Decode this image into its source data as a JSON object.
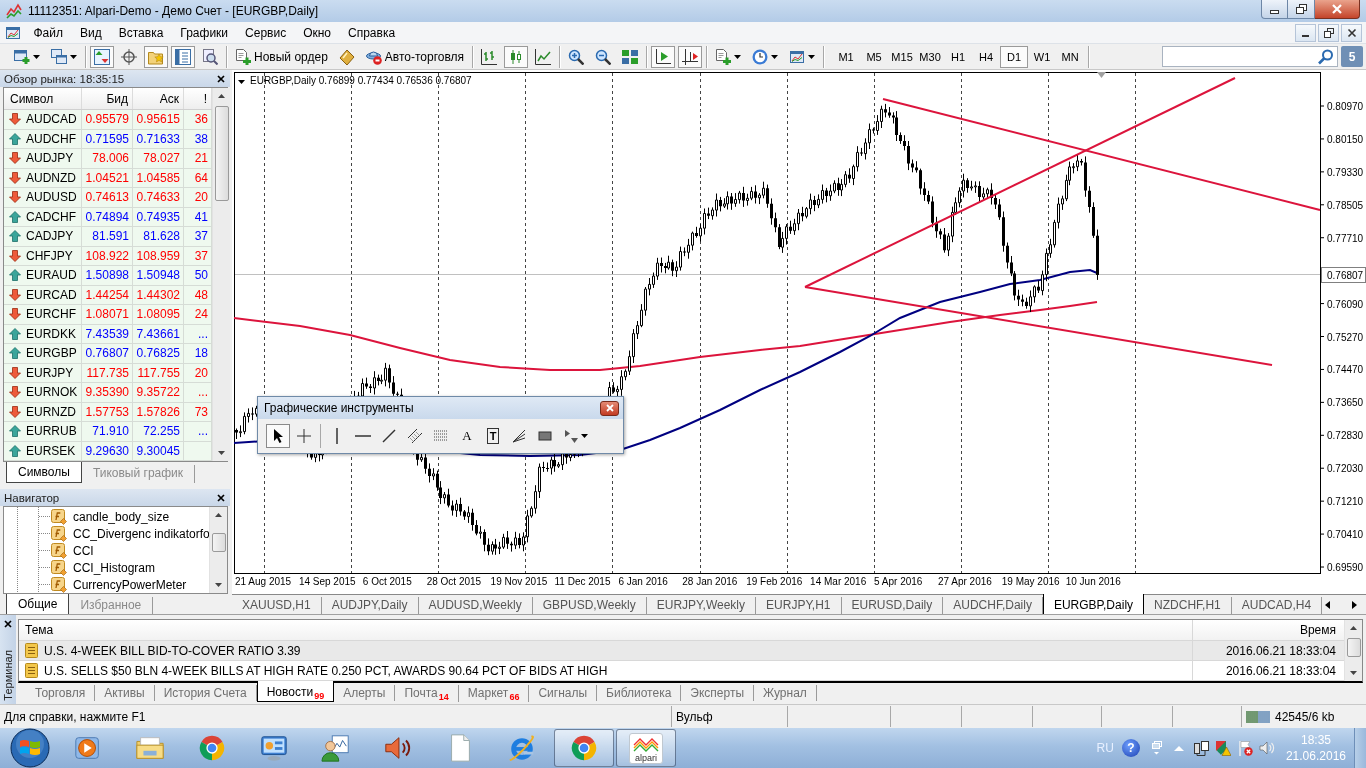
{
  "window": {
    "title": "11112351: Alpari-Demo - Демо Счет - [EURGBP,Daily]"
  },
  "menu": [
    "Файл",
    "Вид",
    "Вставка",
    "Графики",
    "Сервис",
    "Окно",
    "Справка"
  ],
  "toolbar": {
    "groups": [
      [
        {
          "pressed": false,
          "dropdown": true
        },
        {
          "pressed": false,
          "dropdown": true
        }
      ],
      [
        {
          "pressed": true
        },
        {
          "pressed": false
        },
        {
          "pressed": true
        },
        {
          "pressed": true
        },
        {
          "pressed": false
        }
      ],
      [
        {
          "label": "Новый ордер",
          "pressed": false
        },
        {
          "pressed": false
        },
        {
          "label": "Авто-торговля",
          "pressed": false
        }
      ],
      [
        {
          "pressed": false
        },
        {
          "pressed": true
        },
        {
          "pressed": false
        }
      ],
      [
        {
          "pressed": false
        },
        {
          "pressed": false
        },
        {
          "pressed": false
        }
      ],
      [
        {
          "pressed": true
        },
        {
          "pressed": true
        }
      ],
      [
        {
          "pressed": false,
          "dropdown": true
        },
        {
          "pressed": false,
          "dropdown": true
        },
        {
          "pressed": false,
          "dropdown": true
        }
      ]
    ],
    "periods": [
      {
        "label": "M1",
        "selected": false
      },
      {
        "label": "M5",
        "selected": false
      },
      {
        "label": "M15",
        "selected": false
      },
      {
        "label": "M30",
        "selected": false
      },
      {
        "label": "H1",
        "selected": false
      },
      {
        "label": "H4",
        "selected": false
      },
      {
        "label": "D1",
        "selected": true
      },
      {
        "label": "W1",
        "selected": false
      },
      {
        "label": "MN",
        "selected": false
      }
    ],
    "messages": "5"
  },
  "market_watch": {
    "title": "Обзор рынка: 18:35:15",
    "columns": [
      "Символ",
      "Бид",
      "Аск",
      "!"
    ],
    "rows": [
      {
        "symbol": "AUDCAD",
        "bid": "0.95579",
        "ask": "0.95615",
        "spread": "36",
        "rising": false
      },
      {
        "symbol": "AUDCHF",
        "bid": "0.71595",
        "ask": "0.71633",
        "spread": "38",
        "rising": true
      },
      {
        "symbol": "AUDJPY",
        "bid": "78.006",
        "ask": "78.027",
        "spread": "21",
        "rising": false
      },
      {
        "symbol": "AUDNZD",
        "bid": "1.04521",
        "ask": "1.04585",
        "spread": "64",
        "rising": false
      },
      {
        "symbol": "AUDUSD",
        "bid": "0.74613",
        "ask": "0.74633",
        "spread": "20",
        "rising": false
      },
      {
        "symbol": "CADCHF",
        "bid": "0.74894",
        "ask": "0.74935",
        "spread": "41",
        "rising": true
      },
      {
        "symbol": "CADJPY",
        "bid": "81.591",
        "ask": "81.628",
        "spread": "37",
        "rising": true
      },
      {
        "symbol": "CHFJPY",
        "bid": "108.922",
        "ask": "108.959",
        "spread": "37",
        "rising": false
      },
      {
        "symbol": "EURAUD",
        "bid": "1.50898",
        "ask": "1.50948",
        "spread": "50",
        "rising": true
      },
      {
        "symbol": "EURCAD",
        "bid": "1.44254",
        "ask": "1.44302",
        "spread": "48",
        "rising": false
      },
      {
        "symbol": "EURCHF",
        "bid": "1.08071",
        "ask": "1.08095",
        "spread": "24",
        "rising": false
      },
      {
        "symbol": "EURDKK",
        "bid": "7.43539",
        "ask": "7.43661",
        "spread": "...",
        "rising": true
      },
      {
        "symbol": "EURGBP",
        "bid": "0.76807",
        "ask": "0.76825",
        "spread": "18",
        "rising": true
      },
      {
        "symbol": "EURJPY",
        "bid": "117.735",
        "ask": "117.755",
        "spread": "20",
        "rising": false
      },
      {
        "symbol": "EURNOK",
        "bid": "9.35390",
        "ask": "9.35722",
        "spread": "...",
        "rising": false
      },
      {
        "symbol": "EURNZD",
        "bid": "1.57753",
        "ask": "1.57826",
        "spread": "73",
        "rising": false
      },
      {
        "symbol": "EURRUB",
        "bid": "71.910",
        "ask": "72.255",
        "spread": "...",
        "rising": true
      },
      {
        "symbol": "EURSEK",
        "bid": "9.29630",
        "ask": "9.30045",
        "rising": true
      }
    ],
    "tabs": [
      {
        "label": "Символы",
        "selected": true
      },
      {
        "label": "Тиковый график",
        "selected": false
      }
    ]
  },
  "navigator": {
    "title": "Навигатор",
    "items": [
      "candle_body_size",
      "CC_Divergenc indikatorfo",
      "CCI",
      "CCI_Histogram",
      "CurrencyPowerMeter"
    ],
    "tabs": [
      {
        "label": "Общие",
        "selected": true
      },
      {
        "label": "Избранное",
        "selected": false
      }
    ]
  },
  "chart": {
    "header": "EURGBP,Daily  0.76899 0.77434 0.76536 0.76807",
    "price_axis": [
      "0.80970",
      "0.80150",
      "0.79330",
      "0.78505",
      "0.77710",
      "0.76090",
      "0.75270",
      "0.74470",
      "0.73650",
      "0.72830",
      "0.72030",
      "0.71210",
      "0.70410",
      "0.69590"
    ],
    "current_price": "0.76807",
    "time_axis": [
      "21 Aug 2015",
      "14 Sep 2015",
      "6 Oct 2015",
      "28 Oct 2015",
      "19 Nov 2015",
      "11 Dec 2015",
      "6 Jan 2016",
      "28 Jan 2016",
      "19 Feb 2016",
      "14 Mar 2016",
      "5 Apr 2016",
      "27 Apr 2016",
      "19 May 2016",
      "10 Jun 2016"
    ]
  },
  "drawing_tools": {
    "title": "Графические инструменты",
    "groups": [
      [
        {
          "selected": true
        },
        {
          "selected": false
        }
      ],
      [
        {
          "selected": false
        },
        {
          "selected": false
        },
        {
          "selected": false
        },
        {
          "selected": false
        },
        {
          "selected": false
        },
        {
          "glyph": "A",
          "selected": false
        },
        {
          "glyph": "T",
          "selected": false
        },
        {
          "selected": false
        },
        {
          "selected": false
        },
        {
          "selected": false,
          "dropdown": true
        }
      ]
    ]
  },
  "chart_tabs": [
    {
      "label": "XAUUSD,H1",
      "selected": false
    },
    {
      "label": "AUDJPY,Daily",
      "selected": false
    },
    {
      "label": "AUDUSD,Weekly",
      "selected": false
    },
    {
      "label": "GBPUSD,Weekly",
      "selected": false
    },
    {
      "label": "EURJPY,Weekly",
      "selected": false
    },
    {
      "label": "EURJPY,H1",
      "selected": false
    },
    {
      "label": "EURUSD,Daily",
      "selected": false
    },
    {
      "label": "AUDCHF,Daily",
      "selected": false
    },
    {
      "label": "EURGBP,Daily",
      "selected": true
    },
    {
      "label": "NZDCHF,H1",
      "selected": false
    },
    {
      "label": "AUDCAD,H4",
      "selected": false
    }
  ],
  "terminal": {
    "title": "Терминал",
    "columns": [
      "Тема",
      "Время"
    ],
    "rows": [
      {
        "subject": "U.S. 4-WEEK BILL BID-TO-COVER RATIO 3.39",
        "time": "2016.06.21 18:33:04",
        "selected": true
      },
      {
        "subject": "U.S. SELLS $50 BLN 4-WEEK BILLS AT HIGH RATE 0.250 PCT, AWARDS 90.64 PCT OF BIDS AT HIGH",
        "time": "2016.06.21 18:33:04",
        "selected": false
      }
    ],
    "tabs": [
      {
        "label": "Торговля",
        "selected": false
      },
      {
        "label": "Активы",
        "selected": false
      },
      {
        "label": "История Счета",
        "selected": false
      },
      {
        "label": "Новости",
        "badge": "99",
        "selected": true
      },
      {
        "label": "Алерты",
        "selected": false
      },
      {
        "label": "Почта",
        "badge": "14",
        "selected": false
      },
      {
        "label": "Маркет",
        "badge": "66",
        "selected": false
      },
      {
        "label": "Сигналы",
        "selected": false
      },
      {
        "label": "Библиотека",
        "selected": false
      },
      {
        "label": "Эксперты",
        "selected": false
      },
      {
        "label": "Журнал",
        "selected": false
      }
    ]
  },
  "status_bar": {
    "help": "Для справки, нажмите F1",
    "profile": "Вульф",
    "traffic": "42545/6 kb"
  },
  "taskbar": {
    "apps": [
      {
        "running": false
      },
      {
        "running": false
      },
      {
        "running": false
      },
      {
        "running": false
      },
      {
        "running": false
      },
      {
        "running": false
      },
      {
        "running": false
      },
      {
        "running": false
      },
      {
        "running": true
      },
      {
        "running": true,
        "label": "alpari"
      }
    ],
    "language": "RU",
    "help": "?",
    "time": "18:35",
    "date": "21.06.2016"
  }
}
